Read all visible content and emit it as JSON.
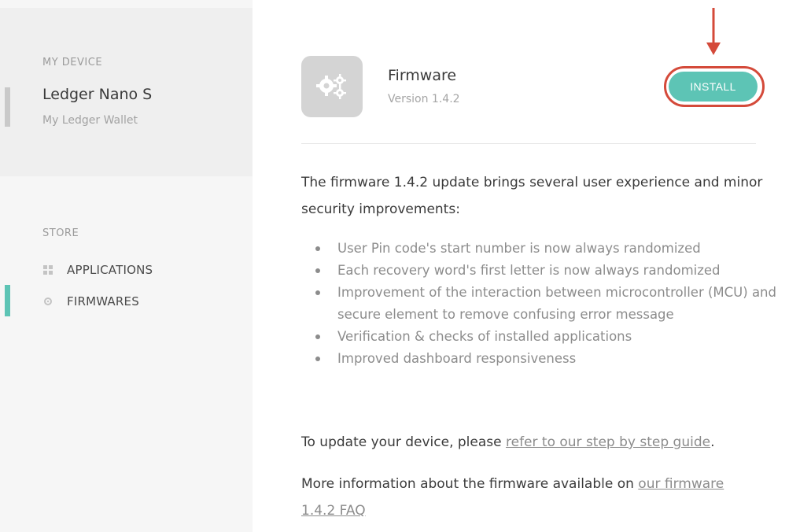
{
  "sidebar": {
    "device_section_label": "MY DEVICE",
    "device_name": "Ledger Nano S",
    "device_subtitle": "My Ledger Wallet",
    "store_section_label": "STORE",
    "items": [
      {
        "label": "APPLICATIONS",
        "icon": "grid-icon",
        "active": false
      },
      {
        "label": "FIRMWARES",
        "icon": "gear-icon",
        "active": true
      }
    ]
  },
  "firmware": {
    "icon": "gears-icon",
    "title": "Firmware",
    "version": "Version 1.4.2",
    "install_label": "INSTALL"
  },
  "content": {
    "intro": "The firmware 1.4.2 update brings several user experience and minor security improvements:",
    "bullets": [
      "User Pin code's start number is now always randomized",
      "Each recovery word's first letter is now always randomized",
      "Improvement of the interaction between microcontroller (MCU) and secure element to remove confusing error message",
      "Verification & checks of installed applications",
      "Improved dashboard responsiveness"
    ],
    "update_text": "To update your device, please ",
    "update_link": "refer to our step by step guide",
    "update_suffix": ".",
    "more_text": "More information about the firmware available on ",
    "more_link": "our firmware 1.4.2 FAQ"
  },
  "colors": {
    "accent": "#5dc4b5",
    "highlight_ring": "#d44a3a",
    "sidebar_bg": "#f6f6f6"
  }
}
